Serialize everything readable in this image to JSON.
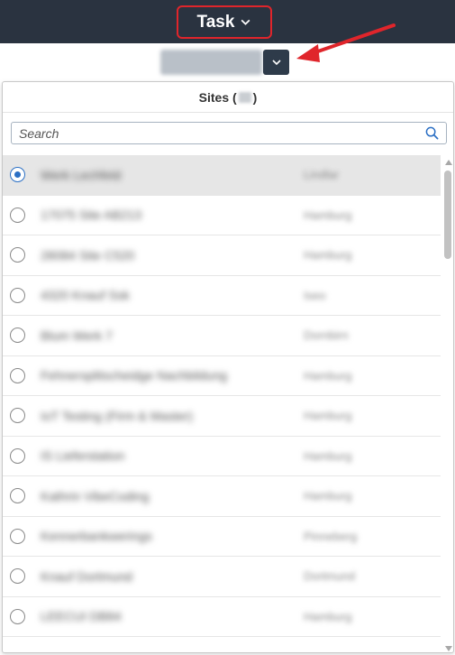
{
  "header": {
    "menu_label": "Task",
    "menu_icon": "chevron-down-icon"
  },
  "site_selector": {
    "icon": "chevron-down-icon"
  },
  "panel": {
    "title": "Sites (",
    "title_suffix": ")",
    "search_placeholder": "Search",
    "search_icon": "search-icon",
    "items": [
      {
        "name": "Werk Lechfeld",
        "city": "Lindlar",
        "selected": true
      },
      {
        "name": "17075 Site AB213",
        "city": "Hamburg",
        "selected": false
      },
      {
        "name": "28084 Site C520",
        "city": "Hamburg",
        "selected": false
      },
      {
        "name": "4320 Knauf Ssk",
        "city": "Iseo",
        "selected": false
      },
      {
        "name": "Blum Werk 7",
        "city": "Dornbirn",
        "selected": false
      },
      {
        "name": "Fehnersplitscheidge Nachbildung",
        "city": "Hamburg",
        "selected": false
      },
      {
        "name": "IoT Testing (Firm & Master)",
        "city": "Hamburg",
        "selected": false
      },
      {
        "name": "IS Lieferstation",
        "city": "Hamburg",
        "selected": false
      },
      {
        "name": "Kathrin VibeCoding",
        "city": "Hamburg",
        "selected": false
      },
      {
        "name": "Kennerbankwerings",
        "city": "Pinneberg",
        "selected": false
      },
      {
        "name": "Knauf Dortmund",
        "city": "Dortmund",
        "selected": false
      },
      {
        "name": "LEECUI DB84",
        "city": "Hamburg",
        "selected": false
      }
    ]
  },
  "colors": {
    "topbar": "#2a3340",
    "highlight": "#e0252b",
    "radio_selected": "#2b6fc4"
  }
}
